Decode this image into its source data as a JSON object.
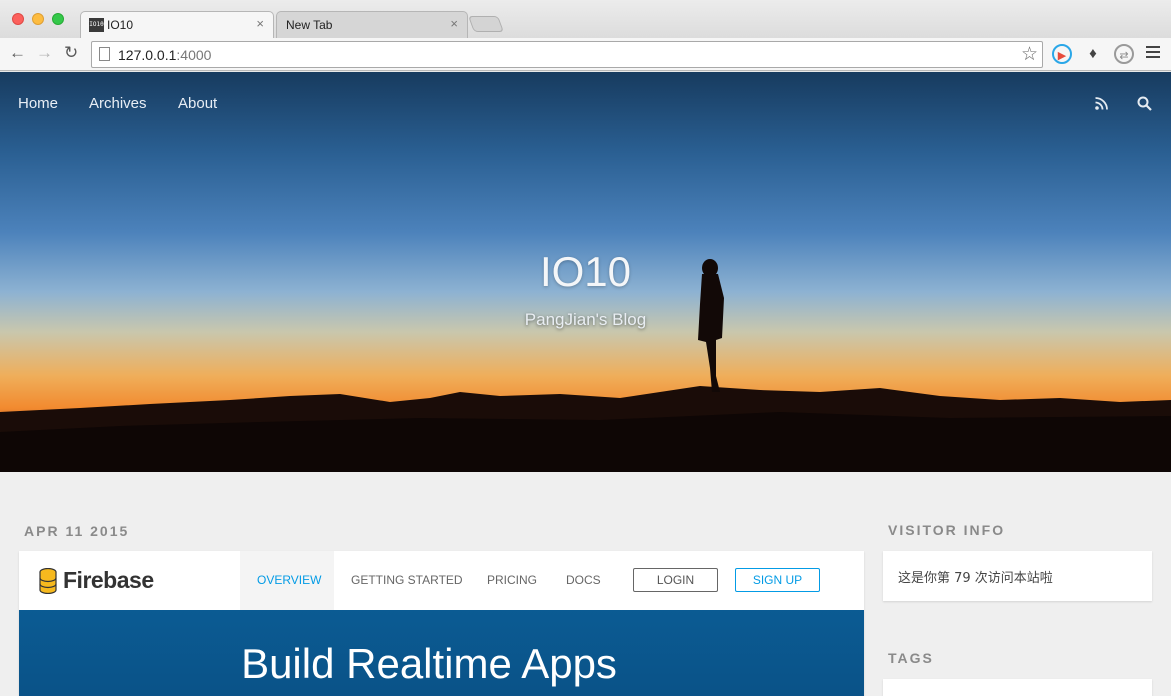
{
  "browser": {
    "tabs": [
      {
        "label": "IO10",
        "favicon_text": "IO10",
        "active": true
      },
      {
        "label": "New Tab",
        "active": false
      }
    ],
    "url_host": "127.0.0.1",
    "url_port": ":4000",
    "close_glyph": "×"
  },
  "nav": {
    "items": [
      {
        "label": "Home"
      },
      {
        "label": "Archives"
      },
      {
        "label": "About"
      }
    ],
    "icons": [
      "rss-icon",
      "search-icon"
    ]
  },
  "hero": {
    "title": "IO10",
    "subtitle": "PangJian's Blog"
  },
  "post": {
    "date": "APR 11 2015",
    "preview": {
      "logo": "Firebase",
      "nav": [
        "OVERVIEW",
        "GETTING STARTED",
        "PRICING",
        "DOCS"
      ],
      "active_nav": "OVERVIEW",
      "login": "LOGIN",
      "signup": "SIGN UP",
      "headline": "Build Realtime Apps"
    }
  },
  "sidebar": {
    "visitor_title": "VISITOR INFO",
    "visitor_text": "这是你第 79 次访问本站啦",
    "tags_title": "TAGS"
  },
  "colors": {
    "firebase_blue": "#039be5",
    "banner_blue": "#0b5b93"
  }
}
